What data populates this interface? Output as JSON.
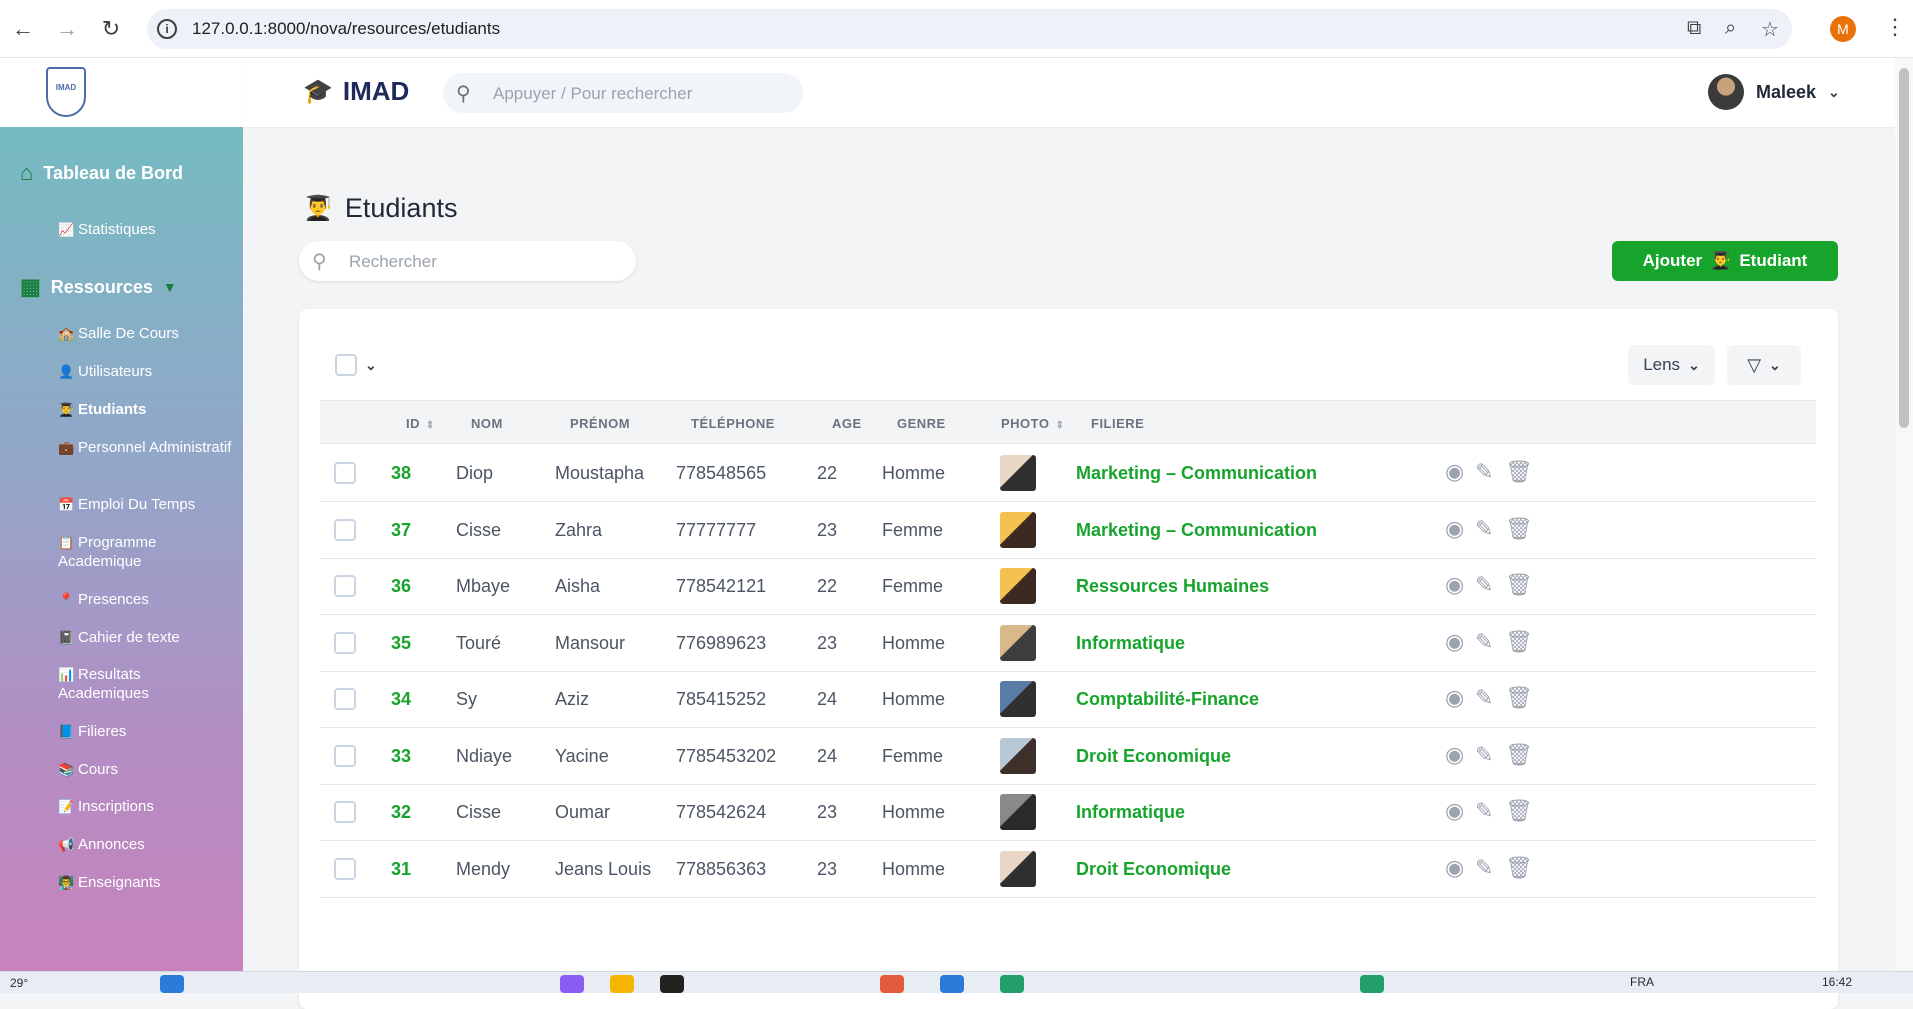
{
  "browser": {
    "url": "127.0.0.1:8000/nova/resources/etudiants",
    "profile_initial": "M"
  },
  "sidebar": {
    "dashboard_label": "Tableau de Bord",
    "statistiques_label": "Statistiques",
    "resources_label": "Ressources",
    "items": [
      {
        "label": "Salle De Cours",
        "emoji": "🏫"
      },
      {
        "label": "Utilisateurs",
        "emoji": "👤"
      },
      {
        "label": "Etudiants",
        "emoji": "👨‍🎓"
      },
      {
        "label": "Personnel Administratif",
        "emoji": "💼"
      },
      {
        "label": "Emploi Du Temps",
        "emoji": "📅"
      },
      {
        "label": "Programme Academique",
        "emoji": "📋"
      },
      {
        "label": "Presences",
        "emoji": "📍"
      },
      {
        "label": "Cahier de texte",
        "emoji": "📓"
      },
      {
        "label": "Resultats Academiques",
        "emoji": "📊"
      },
      {
        "label": "Filieres",
        "emoji": "📘"
      },
      {
        "label": "Cours",
        "emoji": "📚"
      },
      {
        "label": "Inscriptions",
        "emoji": "📝"
      },
      {
        "label": "Annonces",
        "emoji": "📢"
      },
      {
        "label": "Enseignants",
        "emoji": "👨‍🏫"
      }
    ]
  },
  "header": {
    "brand": "IMAD",
    "search_placeholder": "Appuyer / Pour rechercher",
    "user_name": "Maleek"
  },
  "main": {
    "title": "Etudiants",
    "search_placeholder": "Rechercher",
    "add_button_prefix": "Ajouter",
    "add_button_suffix": "Etudiant",
    "lens_label": "Lens"
  },
  "table": {
    "columns": [
      "ID",
      "NOM",
      "PRÉNOM",
      "TÉLÉPHONE",
      "AGE",
      "GENRE",
      "PHOTO",
      "FILIERE"
    ],
    "rows": [
      {
        "id": "38",
        "nom": "Diop",
        "prenom": "Moustapha",
        "telephone": "778548565",
        "age": "22",
        "genre": "Homme",
        "filiere": "Marketing – Communication"
      },
      {
        "id": "37",
        "nom": "Cisse",
        "prenom": "Zahra",
        "telephone": "77777777",
        "age": "23",
        "genre": "Femme",
        "filiere": "Marketing – Communication"
      },
      {
        "id": "36",
        "nom": "Mbaye",
        "prenom": "Aisha",
        "telephone": "778542121",
        "age": "22",
        "genre": "Femme",
        "filiere": "Ressources Humaines"
      },
      {
        "id": "35",
        "nom": "Touré",
        "prenom": "Mansour",
        "telephone": "776989623",
        "age": "23",
        "genre": "Homme",
        "filiere": "Informatique"
      },
      {
        "id": "34",
        "nom": "Sy",
        "prenom": "Aziz",
        "telephone": "785415252",
        "age": "24",
        "genre": "Homme",
        "filiere": "Comptabilité-Finance"
      },
      {
        "id": "33",
        "nom": "Ndiaye",
        "prenom": "Yacine",
        "telephone": "7785453202",
        "age": "24",
        "genre": "Femme",
        "filiere": "Droit Economique"
      },
      {
        "id": "32",
        "nom": "Cisse",
        "prenom": "Oumar",
        "telephone": "778542624",
        "age": "23",
        "genre": "Homme",
        "filiere": "Informatique"
      },
      {
        "id": "31",
        "nom": "Mendy",
        "prenom": "Jeans Louis",
        "telephone": "778856363",
        "age": "23",
        "genre": "Homme",
        "filiere": "Droit Economique"
      }
    ]
  },
  "taskbar": {
    "weather": "29°",
    "lang": "FRA",
    "time": "16:42"
  },
  "colors": {
    "accent_green": "#17a42c",
    "brand_navy": "#1f2a5a"
  }
}
